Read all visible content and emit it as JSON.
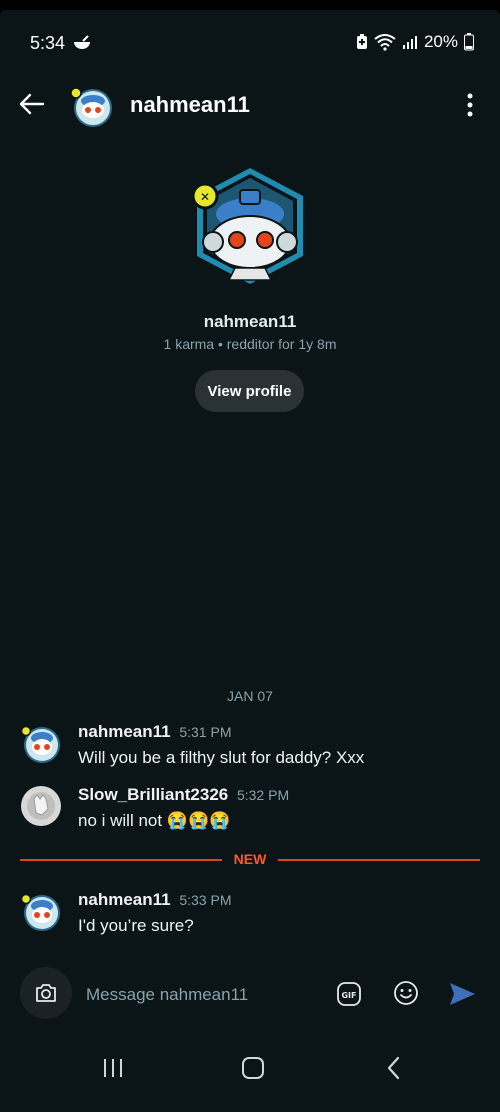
{
  "status_bar": {
    "time": "5:34",
    "battery": "20%"
  },
  "header": {
    "title": "nahmean11",
    "back_icon": "arrow-left-icon",
    "more_icon": "more-vertical-icon"
  },
  "profile": {
    "username": "nahmean11",
    "meta": "1 karma • redditor for 1y 8m",
    "view_profile_label": "View profile"
  },
  "chat": {
    "date_label": "JAN 07",
    "new_label": "NEW",
    "messages": [
      {
        "author": "nahmean11",
        "time": "5:31 PM",
        "text": "Will you be a filthy slut for daddy? Xxx"
      },
      {
        "author": "Slow_Brilliant2326",
        "time": "5:32 PM",
        "text": "no i will not 😭😭😭"
      },
      {
        "author": "nahmean11",
        "time": "5:33 PM",
        "text": "I'd you’re sure?"
      }
    ]
  },
  "composer": {
    "placeholder": "Message nahmean11",
    "camera_icon": "camera-icon",
    "gif_icon": "gif-icon",
    "emoji_icon": "emoji-icon",
    "send_icon": "send-icon"
  },
  "colors": {
    "background": "#0b1416",
    "accent_new": "#d9451c",
    "send": "#3f6fb8",
    "muted_text": "#8ba2ad"
  }
}
